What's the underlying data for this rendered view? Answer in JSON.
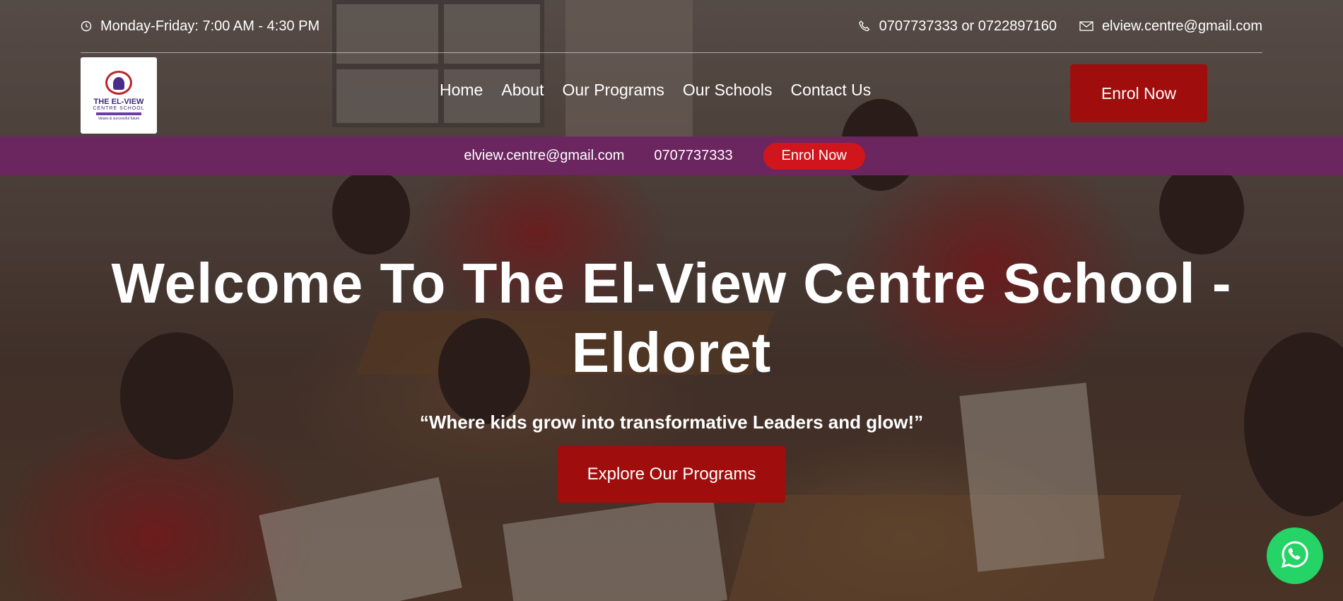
{
  "topbar": {
    "hours": "Monday-Friday: 7:00 AM - 4:30 PM",
    "phones": "0707737333 or 0722897160",
    "email": "elview.centre@gmail.com"
  },
  "logo": {
    "line1": "THE EL-VIEW",
    "line2": "CENTRE SCHOOL",
    "line3": "Values & successful future"
  },
  "nav": {
    "items": [
      "Home",
      "About",
      "Our Programs",
      "Our Schools",
      "Contact Us"
    ],
    "enrol_label": "Enrol Now"
  },
  "strip": {
    "email": "elview.centre@gmail.com",
    "phone": "0707737333",
    "enrol_label": "Enrol Now"
  },
  "hero": {
    "title_line1": "Welcome To The El-View Centre School -",
    "title_line2": "Eldoret",
    "subtitle": "“Where kids grow into transformative Leaders and glow!”",
    "cta_label": "Explore Our Programs"
  },
  "colors": {
    "accent_red": "#a00d0d",
    "strip_purple": "#6b2660",
    "whatsapp_green": "#25d366"
  },
  "icons": [
    "clock-icon",
    "phone-icon",
    "mail-icon",
    "whatsapp-icon"
  ]
}
